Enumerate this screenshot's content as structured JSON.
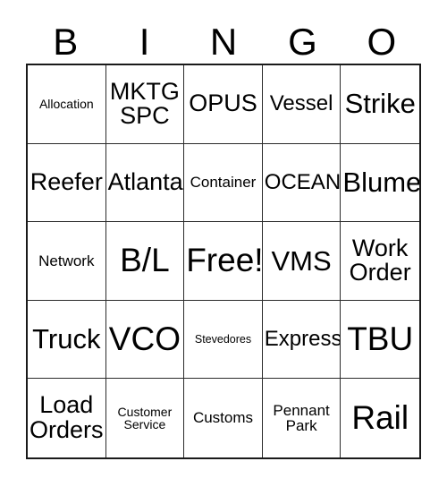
{
  "card": {
    "title": "BINGO",
    "header_letters": [
      "B",
      "I",
      "N",
      "G",
      "O"
    ],
    "colors": {
      "background": "#ffffff",
      "text": "#000000",
      "outer_border": "#1a1a1a",
      "inner_border": "#2b2b2b"
    },
    "grid": {
      "columns": 5,
      "rows": 5,
      "free_space": "Free!",
      "free_space_position": "center"
    },
    "cells": [
      {
        "text": "Allocation",
        "size": "xs"
      },
      {
        "text": "MKTG\nSPC",
        "size": "lg"
      },
      {
        "text": "OPUS",
        "size": "lg"
      },
      {
        "text": "Vessel",
        "size": "md"
      },
      {
        "text": "Strike",
        "size": "xl"
      },
      {
        "text": "Reefer",
        "size": "lg"
      },
      {
        "text": "Atlanta",
        "size": "lg"
      },
      {
        "text": "Container",
        "size": "sm"
      },
      {
        "text": "OCEAN",
        "size": "md"
      },
      {
        "text": "Blume",
        "size": "xl"
      },
      {
        "text": "Network",
        "size": "sm"
      },
      {
        "text": "B/L",
        "size": "xxl"
      },
      {
        "text": "Free!",
        "size": "xxl"
      },
      {
        "text": "VMS",
        "size": "xl"
      },
      {
        "text": "Work\nOrder",
        "size": "lg"
      },
      {
        "text": "Truck",
        "size": "xl"
      },
      {
        "text": "VCO",
        "size": "xxl"
      },
      {
        "text": "Stevedores",
        "size": "xxs"
      },
      {
        "text": "Express",
        "size": "md"
      },
      {
        "text": "TBU",
        "size": "xxl"
      },
      {
        "text": "Load\nOrders",
        "size": "lg"
      },
      {
        "text": "Customer\nService",
        "size": "xs"
      },
      {
        "text": "Customs",
        "size": "sm"
      },
      {
        "text": "Pennant\nPark",
        "size": "sm"
      },
      {
        "text": "Rail",
        "size": "xxl"
      }
    ]
  }
}
